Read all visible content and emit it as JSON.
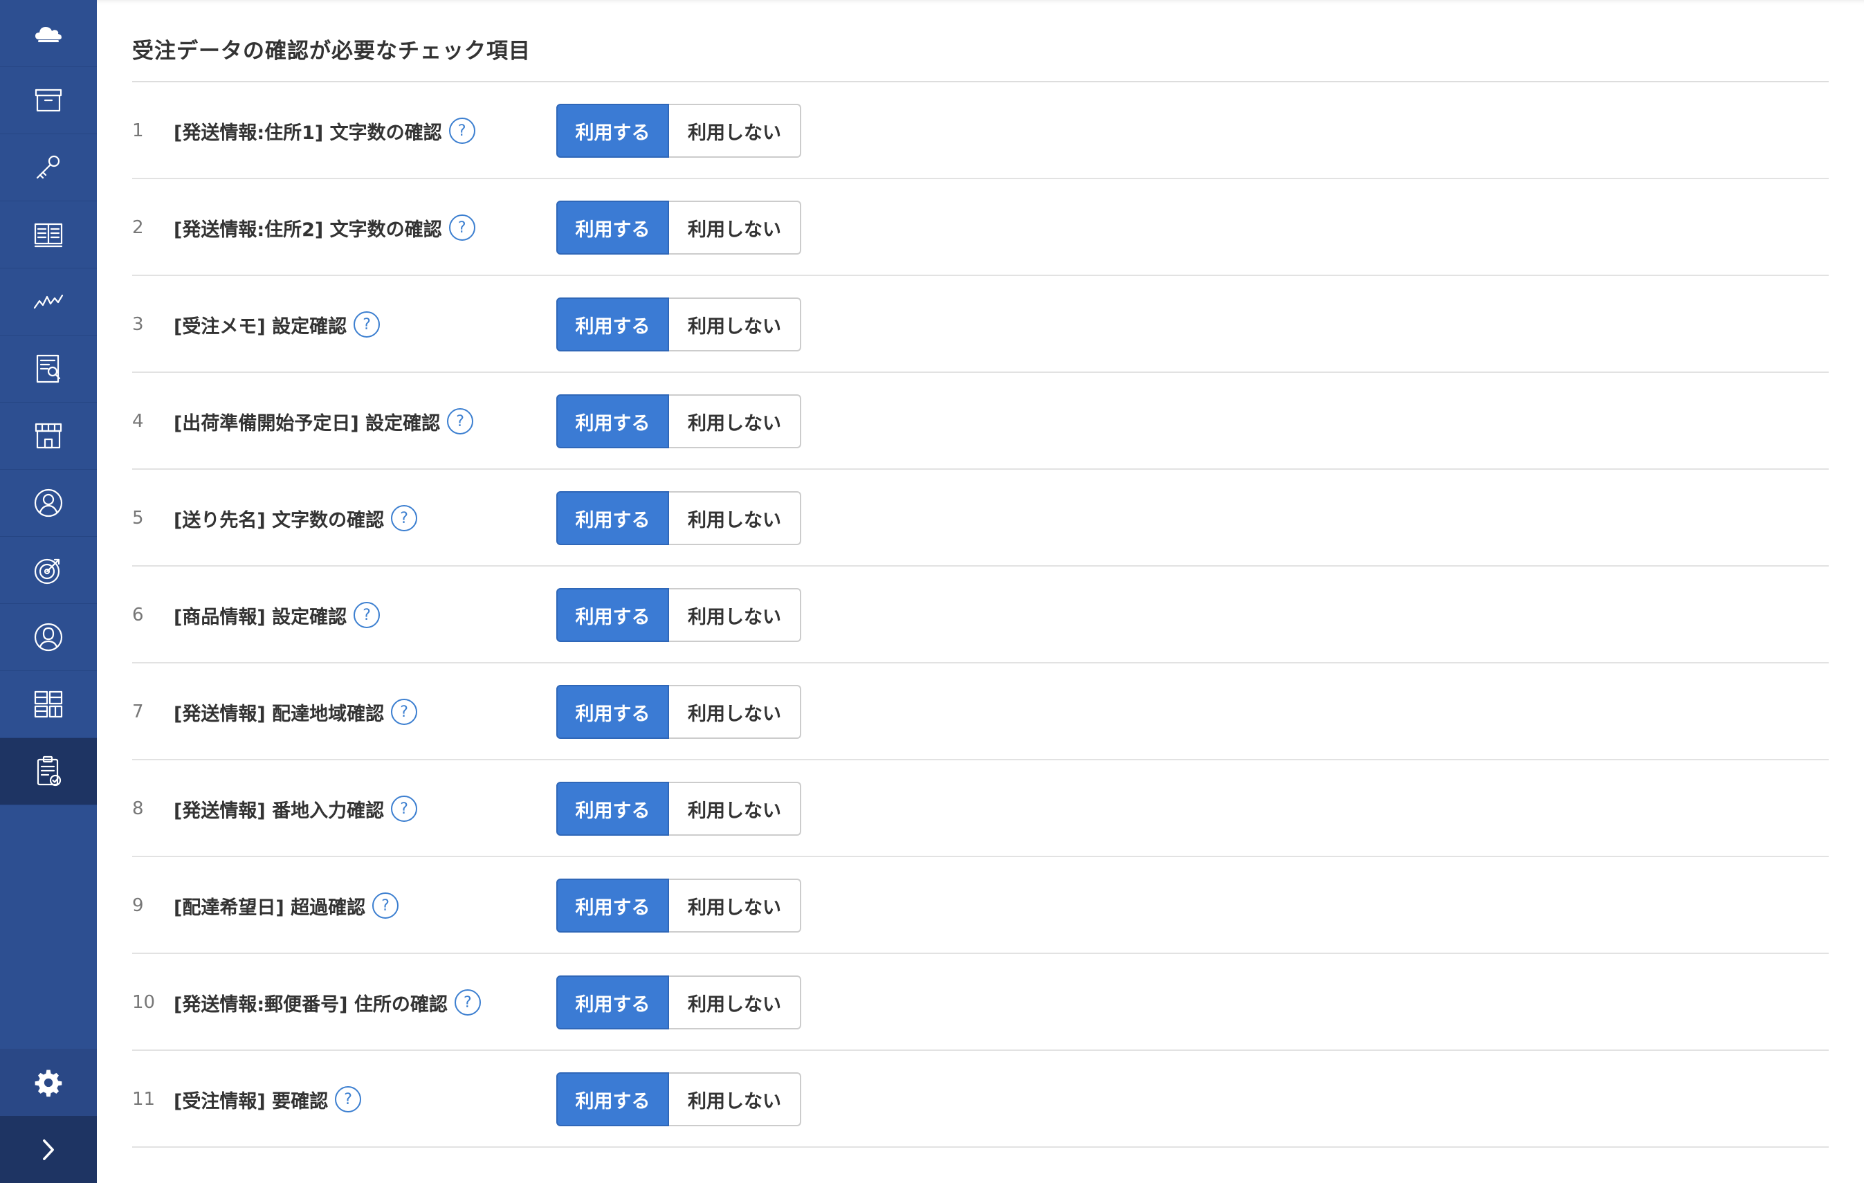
{
  "sidebar": {
    "items": [
      {
        "icon": "cloud-icon"
      },
      {
        "icon": "archive-box-icon"
      },
      {
        "icon": "key-icon"
      },
      {
        "icon": "book-icon"
      },
      {
        "icon": "line-chart-icon"
      },
      {
        "icon": "report-icon"
      },
      {
        "icon": "store-icon"
      },
      {
        "icon": "user-circle-icon"
      },
      {
        "icon": "target-icon"
      },
      {
        "icon": "person-icon"
      },
      {
        "icon": "grid-icon"
      },
      {
        "icon": "clipboard-check-icon",
        "active": true
      }
    ],
    "settings_icon": "gear-icon",
    "expand_icon": "chevron-right-icon"
  },
  "main": {
    "title": "受注データの確認が必要なチェック項目",
    "toggle": {
      "on_label": "利用する",
      "off_label": "利用しない"
    },
    "help_symbol": "?",
    "rows": [
      {
        "num": "1",
        "label": "[発送情報:住所1] 文字数の確認",
        "value": "利用する"
      },
      {
        "num": "2",
        "label": "[発送情報:住所2] 文字数の確認",
        "value": "利用する"
      },
      {
        "num": "3",
        "label": "[受注メモ] 設定確認",
        "value": "利用する"
      },
      {
        "num": "4",
        "label": "[出荷準備開始予定日] 設定確認",
        "value": "利用する"
      },
      {
        "num": "5",
        "label": "[送り先名] 文字数の確認",
        "value": "利用する"
      },
      {
        "num": "6",
        "label": "[商品情報] 設定確認",
        "value": "利用する"
      },
      {
        "num": "7",
        "label": "[発送情報] 配達地域確認",
        "value": "利用する"
      },
      {
        "num": "8",
        "label": "[発送情報] 番地入力確認",
        "value": "利用する"
      },
      {
        "num": "9",
        "label": "[配達希望日] 超過確認",
        "value": "利用する"
      },
      {
        "num": "10",
        "label": "[発送情報:郵便番号] 住所の確認",
        "value": "利用する"
      },
      {
        "num": "11",
        "label": "[受注情報] 要確認",
        "value": "利用する"
      }
    ]
  },
  "colors": {
    "sidebar_bg": "#2d4f91",
    "sidebar_active": "#1e3463",
    "accent": "#3b7bd4"
  }
}
